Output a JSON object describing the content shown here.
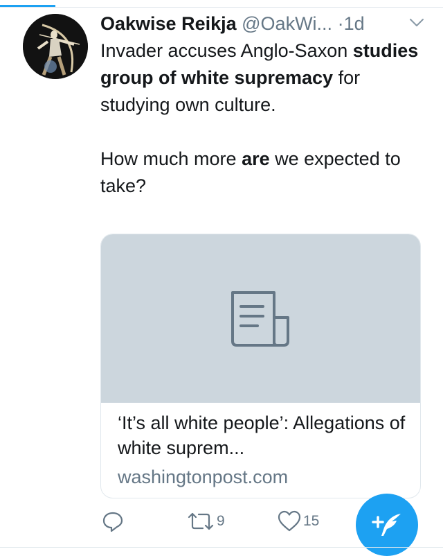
{
  "tweet": {
    "display_name": "Oakwise Reikja",
    "handle": "@OakWi...",
    "separator": "·",
    "time": "1d",
    "text": {
      "p1": [
        {
          "text": "Invader accuses Anglo-Saxon ",
          "bold": false
        },
        {
          "text": "studies group of white supremacy",
          "bold": true
        },
        {
          "text": " for studying own culture.",
          "bold": false
        }
      ],
      "p2": [
        {
          "text": "How much more ",
          "bold": false
        },
        {
          "text": "are",
          "bold": true
        },
        {
          "text": " we expected to take?",
          "bold": false
        }
      ]
    }
  },
  "card": {
    "title": "‘It’s all white people’: Allegations of white suprem...",
    "domain": "washingtonpost.com"
  },
  "actions": {
    "retweet_count": "9",
    "like_count": "15"
  },
  "icons": {
    "avatar": "archer-avatar",
    "more": "chevron-down-icon",
    "card": "article-icon",
    "reply": "reply-icon",
    "retweet": "retweet-icon",
    "like": "heart-icon",
    "compose": "compose-tweet-icon"
  },
  "colors": {
    "accent": "#1da1f2",
    "text": "#14171a",
    "secondary": "#657786",
    "card_image_bg": "#ccd6dd",
    "divider": "#e1e8ed"
  }
}
